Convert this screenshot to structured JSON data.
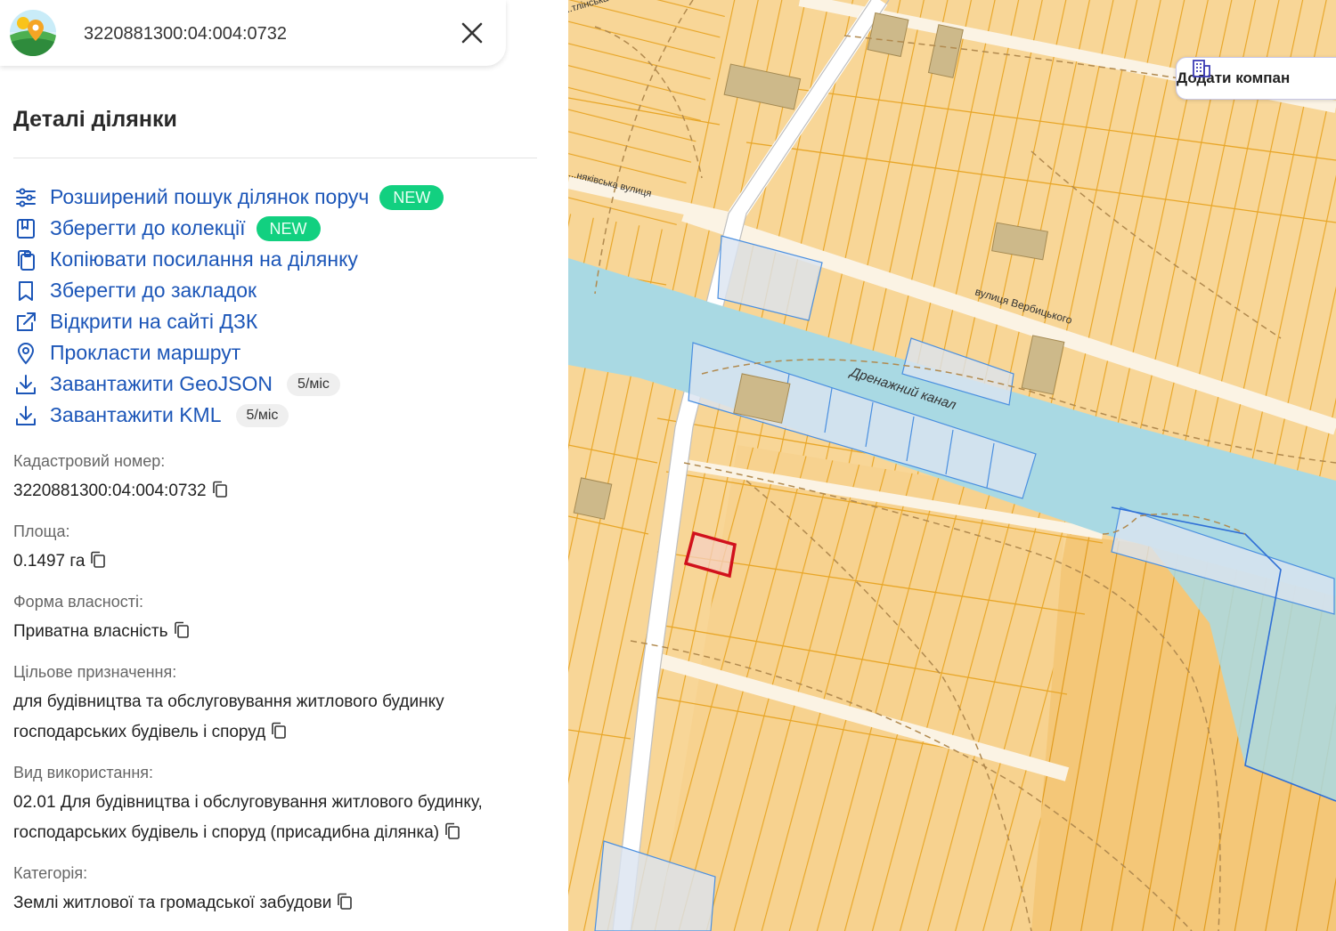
{
  "search": {
    "value": "3220881300:04:004:0732"
  },
  "panel": {
    "title": "Деталі ділянки"
  },
  "actions": [
    {
      "label": "Розширений пошук ділянок поруч",
      "badge": "NEW"
    },
    {
      "label": "Зберегти до колекції",
      "badge": "NEW"
    },
    {
      "label": "Копіювати посилання на ділянку"
    },
    {
      "label": "Зберегти до закладок"
    },
    {
      "label": "Відкрити на сайті ДЗК"
    },
    {
      "label": "Прокласти маршрут"
    },
    {
      "label": "Завантажити GeoJSON",
      "limit": "5/міс"
    },
    {
      "label": "Завантажити KML",
      "limit": "5/міс"
    }
  ],
  "details": {
    "cadastral": {
      "label": "Кадастровий номер:",
      "value": "3220881300:04:004:0732"
    },
    "area": {
      "label": "Площа:",
      "value": "0.1497 га"
    },
    "ownership": {
      "label": "Форма власності:",
      "value": "Приватна власність"
    },
    "purpose": {
      "label": "Цільове призначення:",
      "value": "для будівництва та обслуговування житлового будинку господарських будівель і споруд"
    },
    "usage": {
      "label": "Вид використання:",
      "value": "02.01 Для будівництва і обслуговування житлового будинку, господарських будівель і споруд (присадибна ділянка)"
    },
    "category": {
      "label": "Категорія:",
      "value": "Землі житлової та громадської забудови"
    }
  },
  "map": {
    "add_company_label": "Додати компан",
    "labels": {
      "street_a": "...тлінська",
      "street_b": "...няківська вулиця",
      "street_verbytskoho": "вулиця Вербицького",
      "canal": "Дренажний канал"
    }
  },
  "colors": {
    "link": "#1c56b8",
    "badge_new": "#12d080",
    "parcel_fill": "#f8d697",
    "parcel_border": "#e8a628",
    "water": "#a9d9e3",
    "selected_parcel": "#d1111c"
  }
}
